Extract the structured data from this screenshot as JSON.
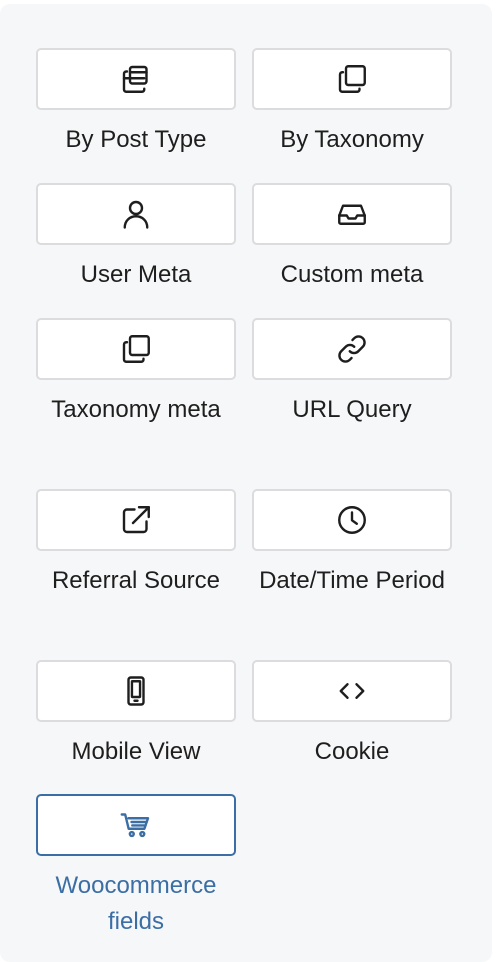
{
  "rules": [
    {
      "label": "By Post Type",
      "icon": "stacked-windows-icon"
    },
    {
      "label": "By Taxonomy",
      "icon": "copy-squares-icon"
    },
    {
      "label": "User Meta",
      "icon": "user-icon"
    },
    {
      "label": "Custom meta",
      "icon": "inbox-tray-icon"
    },
    {
      "label": "Taxonomy meta",
      "icon": "copy-squares-icon"
    },
    {
      "label": "URL Query",
      "icon": "link-icon"
    },
    {
      "label": "Referral Source",
      "icon": "external-link-icon"
    },
    {
      "label": "Date/Time Period",
      "icon": "clock-icon"
    },
    {
      "label": "Mobile View",
      "icon": "mobile-phone-icon"
    },
    {
      "label": "Cookie",
      "icon": "code-brackets-icon"
    },
    {
      "label": "Woocommerce fields",
      "icon": "shopping-cart-icon",
      "selected": true
    }
  ],
  "colors": {
    "accent": "#3b6ea5",
    "text": "#1e1e1e",
    "border": "#dcdcde",
    "panel_bg": "#f6f7f8"
  }
}
